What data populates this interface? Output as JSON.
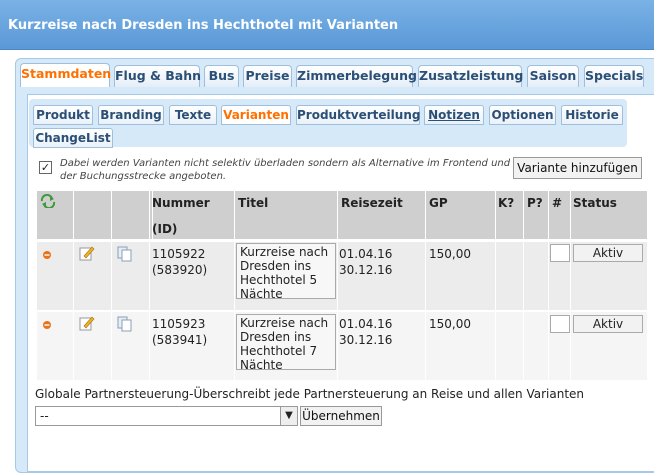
{
  "header": {
    "title": "Kurzreise nach Dresden ins Hechthotel mit Varianten"
  },
  "main_tabs": [
    "Stammdaten",
    "Flug & Bahn",
    "Bus",
    "Preise",
    "Zimmerbelegung",
    "Zusatzleistung",
    "Saison",
    "Specials"
  ],
  "sub_tabs": [
    "Produkt",
    "Branding",
    "Texte",
    "Varianten",
    "Produktverteilung",
    "Notizen",
    "Optionen",
    "Historie",
    "ChangeList"
  ],
  "active_main_tab": "Stammdaten",
  "active_sub_tab": "Varianten",
  "note": "Dabei werden Varianten nicht selektiv überladen sondern als Alternative im Frontend und der Buchungsstrecke angeboten.",
  "add_variant_button": "Variante hinzufügen",
  "table": {
    "headers": {
      "nummer": "Nummer",
      "id": "(ID)",
      "titel": "Titel",
      "reisezeit": "Reisezeit",
      "gp": "GP",
      "k": "K?",
      "p": "P?",
      "hash": "#",
      "status": "Status"
    },
    "rows": [
      {
        "nummer": "1105922",
        "id": "(583920)",
        "titel": "Kurzreise nach Dresden ins Hechthotel 5 Nächte",
        "von": "01.04.16",
        "bis": "30.12.16",
        "gp": "150,00",
        "status": "Aktiv"
      },
      {
        "nummer": "1105923",
        "id": "(583941)",
        "titel": "Kurzreise nach Dresden ins Hechthotel 7 Nächte",
        "von": "01.04.16",
        "bis": "30.12.16",
        "gp": "150,00",
        "status": "Aktiv"
      }
    ]
  },
  "global": {
    "label": "Globale Partnersteuerung-Überschreibt jede Partnersteuerung an Reise und allen Varianten",
    "select_value": "--",
    "apply_button": "Übernehmen"
  },
  "icons": [
    "refresh-icon",
    "remove-icon",
    "edit-icon",
    "copy-icon",
    "checkmark-icon",
    "dropdown-arrow-icon"
  ],
  "colors": {
    "header": "#5a98d6",
    "active_tab": "#ff7000",
    "tab_text": "#2b4f75",
    "panel": "#d6e9f8"
  }
}
